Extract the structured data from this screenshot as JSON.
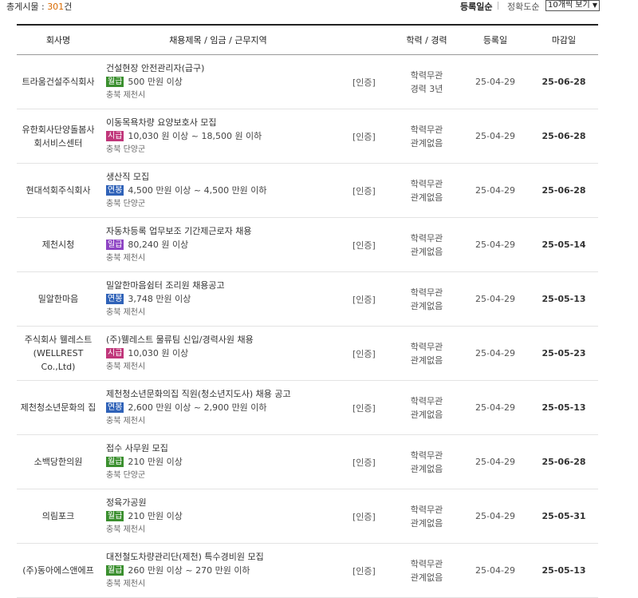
{
  "summary": {
    "label": "총게시물 : ",
    "count": "301",
    "unit": "건"
  },
  "sort": {
    "registration": "등록일순",
    "accuracy": "정확도순"
  },
  "per_page": {
    "selected": "10개씩 보기"
  },
  "columns": [
    "회사명",
    "채용제목 / 임금 / 근무지역",
    "",
    "학력 / 경력",
    "등록일",
    "마감일"
  ],
  "colors": {
    "monthly": "#3a8f2e",
    "hourly": "#c0367a",
    "annual": "#2f62b8",
    "daily": "#8e44c4",
    "count_accent": "#d96a00"
  },
  "rows": [
    {
      "company": [
        "트라움건설주식회사"
      ],
      "title": "건설현장 안전관리자(급구)",
      "pay_type": "월급",
      "pay_color": "#3a8f2e",
      "pay": "500 만원 이상",
      "region": "충북 제천시",
      "cert": "[인증]",
      "edu": "학력무관",
      "career": "경력 3년",
      "reg_date": "25-04-29",
      "deadline": "25-06-28"
    },
    {
      "company": [
        "유한회사단양돌봄사",
        "회서비스센터"
      ],
      "title": "이동목욕차량 요양보호사 모집",
      "pay_type": "시급",
      "pay_color": "#c0367a",
      "pay": "10,030 원 이상 ~ 18,500 원 이하",
      "region": "충북 단양군",
      "cert": "[인증]",
      "edu": "학력무관",
      "career": "관계없음",
      "reg_date": "25-04-29",
      "deadline": "25-06-28"
    },
    {
      "company": [
        "현대석회주식회사"
      ],
      "title": "생산직 모집",
      "pay_type": "연봉",
      "pay_color": "#2f62b8",
      "pay": "4,500 만원 이상 ~ 4,500 만원 이하",
      "region": "충북 단양군",
      "cert": "[인증]",
      "edu": "학력무관",
      "career": "관계없음",
      "reg_date": "25-04-29",
      "deadline": "25-06-28"
    },
    {
      "company": [
        "제천시청"
      ],
      "title": "자동차등록 업무보조 기간제근로자 채용",
      "pay_type": "일급",
      "pay_color": "#8e44c4",
      "pay": "80,240 원 이상",
      "region": "충북 제천시",
      "cert": "[인증]",
      "edu": "학력무관",
      "career": "관계없음",
      "reg_date": "25-04-29",
      "deadline": "25-05-14"
    },
    {
      "company": [
        "밀알한마음"
      ],
      "title": "밀알한마음쉼터 조리원 채용공고",
      "pay_type": "연봉",
      "pay_color": "#2f62b8",
      "pay": "3,748 만원 이상",
      "region": "충북 제천시",
      "cert": "[인증]",
      "edu": "학력무관",
      "career": "관계없음",
      "reg_date": "25-04-29",
      "deadline": "25-05-13"
    },
    {
      "company": [
        "주식회사 웰레스트",
        "(WELLREST Co.,Ltd)"
      ],
      "title": "(주)웰레스트 물류팀 신입/경력사원 채용",
      "pay_type": "시급",
      "pay_color": "#c0367a",
      "pay": "10,030 원 이상",
      "region": "충북 제천시",
      "cert": "[인증]",
      "edu": "학력무관",
      "career": "관계없음",
      "reg_date": "25-04-29",
      "deadline": "25-05-23"
    },
    {
      "company": [
        "제천청소년문화의 집"
      ],
      "title": "제천청소년문화의집 직원(청소년지도사) 채용 공고",
      "pay_type": "연봉",
      "pay_color": "#2f62b8",
      "pay": "2,600 만원 이상 ~ 2,900 만원 이하",
      "region": "충북 제천시",
      "cert": "[인증]",
      "edu": "학력무관",
      "career": "관계없음",
      "reg_date": "25-04-29",
      "deadline": "25-05-13"
    },
    {
      "company": [
        "소백당한의원"
      ],
      "title": "접수 사무원 모집",
      "pay_type": "월급",
      "pay_color": "#3a8f2e",
      "pay": "210 만원 이상",
      "region": "충북 단양군",
      "cert": "[인증]",
      "edu": "학력무관",
      "career": "관계없음",
      "reg_date": "25-04-29",
      "deadline": "25-06-28"
    },
    {
      "company": [
        "의림포크"
      ],
      "title": "정육가공원",
      "pay_type": "월급",
      "pay_color": "#3a8f2e",
      "pay": "210 만원 이상",
      "region": "충북 제천시",
      "cert": "[인증]",
      "edu": "학력무관",
      "career": "관계없음",
      "reg_date": "25-04-29",
      "deadline": "25-05-31"
    },
    {
      "company": [
        "(주)동아에스앤에프"
      ],
      "title": "대전철도차량관리단(제천) 특수경비원 모집",
      "pay_type": "월급",
      "pay_color": "#3a8f2e",
      "pay": "260 만원 이상 ~ 270 만원 이하",
      "region": "충북 제천시",
      "cert": "[인증]",
      "edu": "학력무관",
      "career": "관계없음",
      "reg_date": "25-04-29",
      "deadline": "25-05-13"
    }
  ]
}
